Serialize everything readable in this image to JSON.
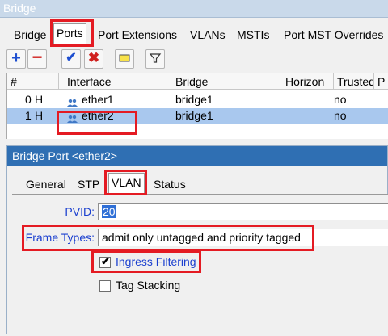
{
  "window": {
    "title": "Bridge"
  },
  "tabs": [
    {
      "label": "Bridge"
    },
    {
      "label": "Ports"
    },
    {
      "label": "Port Extensions"
    },
    {
      "label": "VLANs"
    },
    {
      "label": "MSTIs"
    },
    {
      "label": "Port MST Overrides"
    }
  ],
  "toolbar": {
    "icons": [
      "plus-icon",
      "minus-icon",
      "check-icon",
      "cross-icon",
      "comment-icon",
      "filter-icon"
    ]
  },
  "table": {
    "columns": [
      "#",
      "Interface",
      "Bridge",
      "Horizon",
      "Trusted",
      "P"
    ],
    "rows": [
      {
        "num": "0",
        "flag": "H",
        "interface": "ether1",
        "bridge": "bridge1",
        "trusted": "no"
      },
      {
        "num": "1",
        "flag": "H",
        "interface": "ether2",
        "bridge": "bridge1",
        "trusted": "no"
      }
    ]
  },
  "dialog": {
    "title": "Bridge Port <ether2>",
    "tabs": [
      {
        "label": "General"
      },
      {
        "label": "STP"
      },
      {
        "label": "VLAN"
      },
      {
        "label": "Status"
      }
    ],
    "pvid_label": "PVID:",
    "pvid_value": "20",
    "frame_types_label": "Frame Types:",
    "frame_types_value": "admit only untagged and priority tagged",
    "ingress_filtering_label": "Ingress Filtering",
    "ingress_filtering_checked": true,
    "tag_stacking_label": "Tag Stacking",
    "tag_stacking_checked": false
  },
  "colors": {
    "highlight": "#e41b23",
    "selection": "#a9c8ee",
    "dialog_title": "#2f6fb3",
    "label_blue": "#1a3fcf"
  }
}
